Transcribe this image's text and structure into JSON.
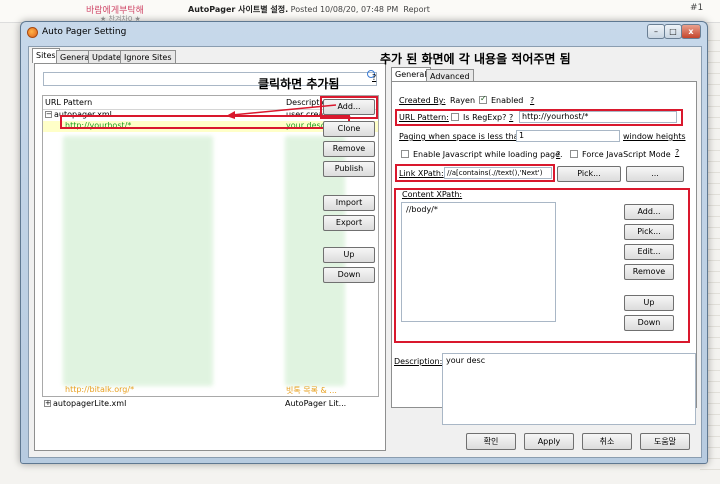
{
  "background": {
    "nickname": "바람에게부탁해",
    "sub_text": "★ 찬겨차0 ★",
    "post_title": "AutoPager 사이트별 설정.",
    "post_meta": "Posted 10/08/20, 07:48 PM",
    "post_report": "Report",
    "post_number": "#1"
  },
  "window": {
    "title": "Auto Pager Setting",
    "minimize": "–",
    "maximize": "□",
    "close": "x"
  },
  "left_tabs": [
    "Sites",
    "General",
    "Update",
    "Ignore Sites"
  ],
  "list": {
    "col_pattern": "URL Pattern",
    "col_desc": "Description",
    "group1_name": "autopager.xml",
    "group1_desc": "user created c...",
    "selected_pattern": "http://yourhost/*",
    "selected_desc": "your desc",
    "last_pattern": "http://bitalk.org/*",
    "last_desc": "빗톡 목록 & ...",
    "group2_name": "autopagerLite.xml",
    "group2_desc": "AutoPager Lit..."
  },
  "side_buttons": {
    "add": "Add...",
    "clone": "Clone",
    "remove": "Remove",
    "publish": "Publish",
    "import": "Import",
    "export": "Export",
    "up": "Up",
    "down": "Down"
  },
  "right_tabs": [
    "General",
    "Advanced"
  ],
  "form": {
    "created_by_label": "Created By:",
    "created_by_value": "Rayen",
    "enabled_label": "Enabled",
    "help": "?",
    "url_pattern_label": "URL Pattern:",
    "is_regexp_label": "Is RegExp?",
    "url_pattern_value": "http://yourhost/*",
    "paging_label": "Paging when space is less than",
    "paging_value": "1",
    "paging_unit": "window heights",
    "enable_js_label": "Enable Javascript while loading page.",
    "force_js_label": "Force JavaScript Mode",
    "link_xpath_label": "Link XPath:",
    "link_xpath_value": "//a[contains(.//text(),'Next')",
    "pick_button": "Pick...",
    "more_button": "...",
    "content_xpath_label": "Content XPath:",
    "content_xpath_value": "//body/*",
    "cx_add": "Add...",
    "cx_pick": "Pick...",
    "cx_edit": "Edit...",
    "cx_remove": "Remove",
    "cx_up": "Up",
    "cx_down": "Down",
    "description_label": "Description:",
    "description_value": "your desc"
  },
  "bottom_buttons": {
    "ok": "확인",
    "apply": "Apply",
    "cancel": "취소",
    "help": "도움말"
  },
  "annotations": {
    "click_add": "클릭하면 추가됨",
    "fill_in": "추가 된 화면에 각 내용을 적어주면 됨"
  },
  "colors": {
    "highlight_red": "#d9182d",
    "selected_row": "#ffffc8",
    "link_green": "#1e9e1e",
    "orange_text": "#e8a020"
  }
}
